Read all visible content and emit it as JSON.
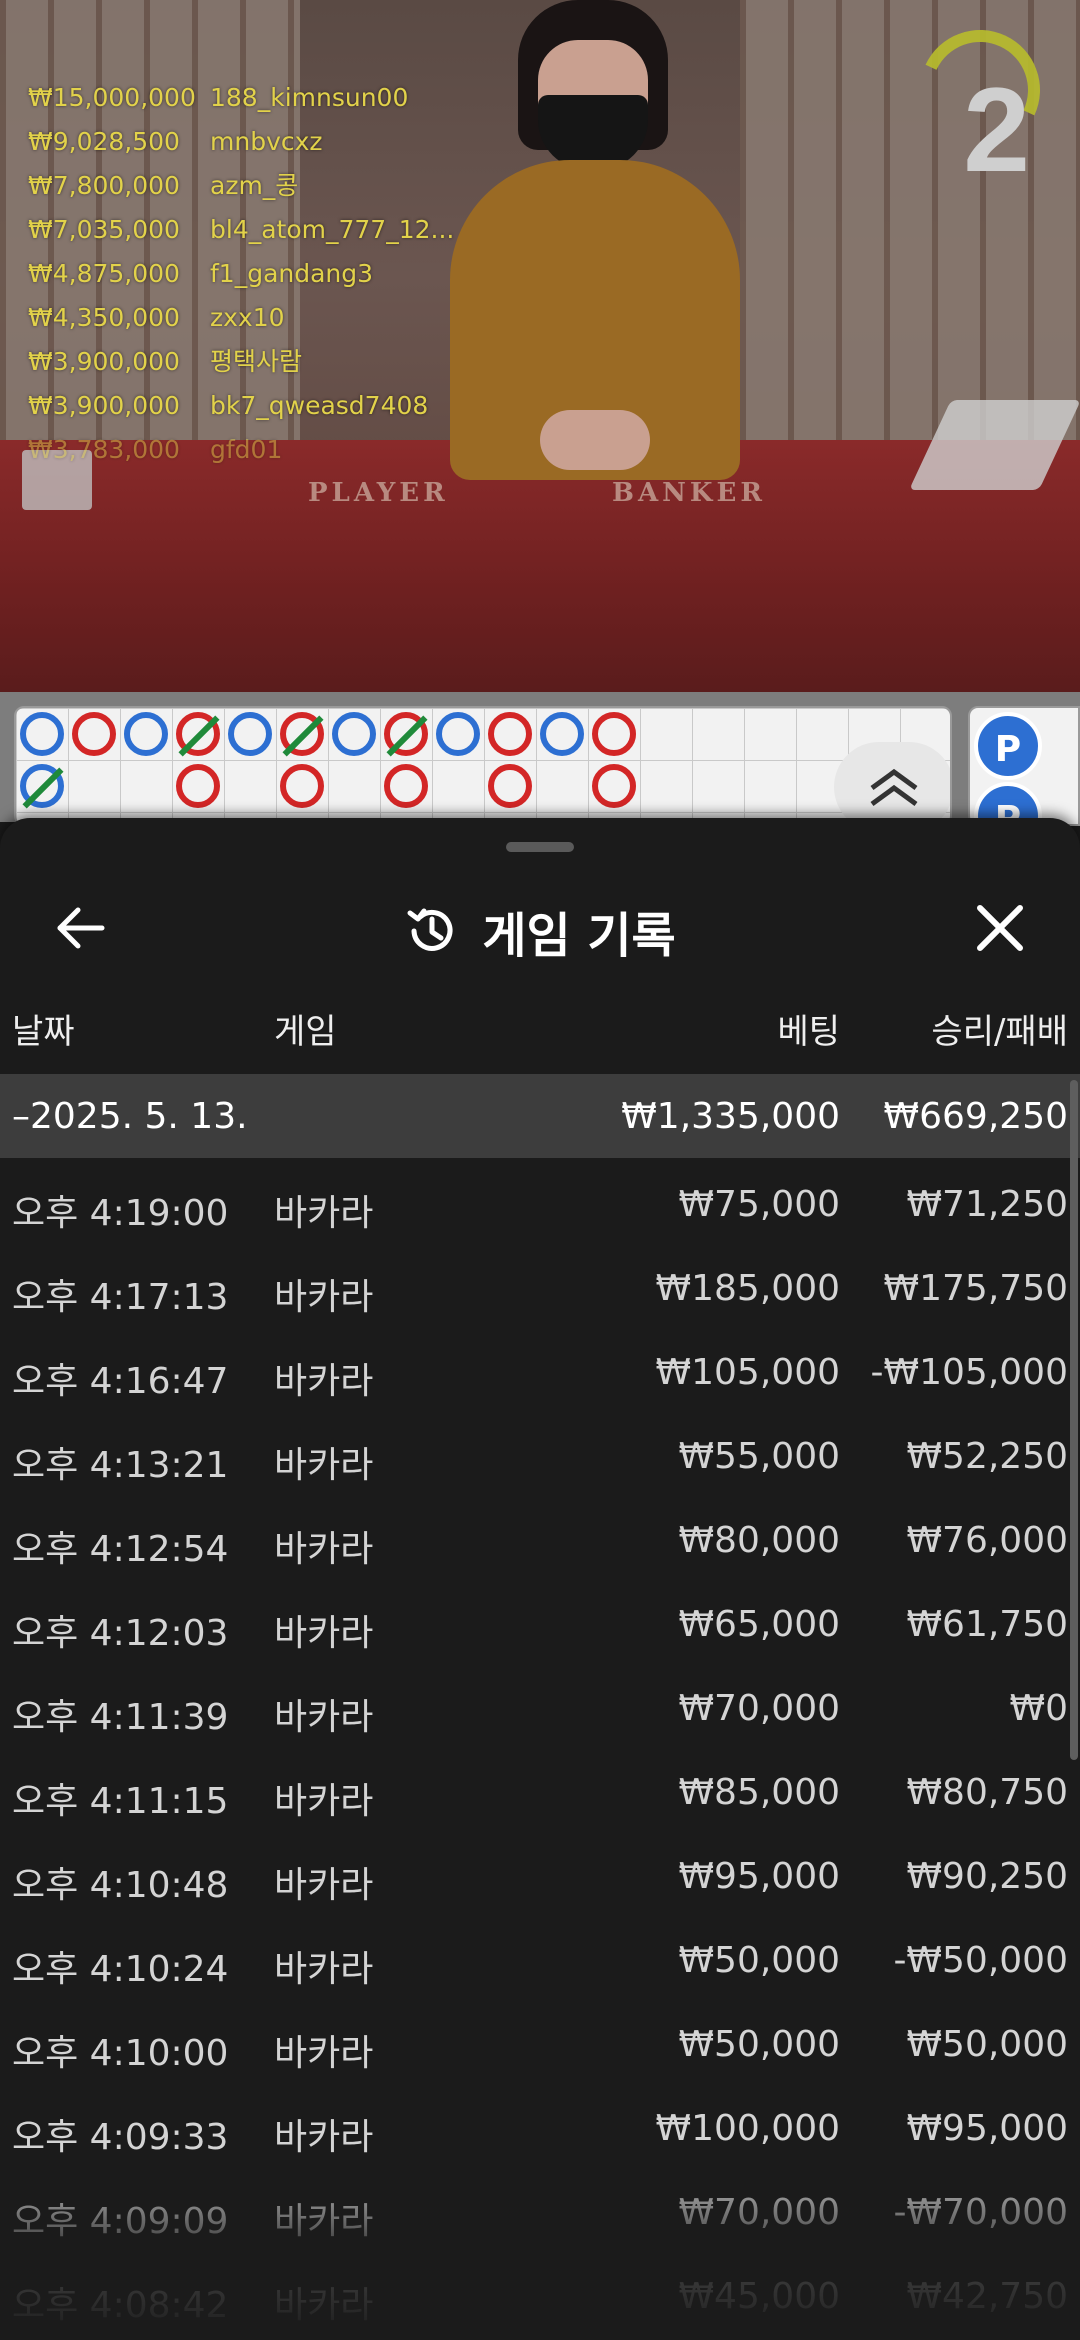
{
  "top_wins": [
    {
      "amount": "₩15,000,000",
      "user": "188_kimnsun00"
    },
    {
      "amount": "₩9,028,500",
      "user": "mnbvcxz"
    },
    {
      "amount": "₩7,800,000",
      "user": "azm_콩"
    },
    {
      "amount": "₩7,035,000",
      "user": "bl4_atom_777_12..."
    },
    {
      "amount": "₩4,875,000",
      "user": "f1_gandang3"
    },
    {
      "amount": "₩4,350,000",
      "user": "zxx10"
    },
    {
      "amount": "₩3,900,000",
      "user": "평택사람"
    },
    {
      "amount": "₩3,900,000",
      "user": "bk7_qweasd7408"
    },
    {
      "amount": "₩3,783,000",
      "user": "gfd01"
    }
  ],
  "timer": {
    "countdown": "2"
  },
  "table": {
    "player_label": "PLAYER",
    "banker_label": "BANKER"
  },
  "side_road": {
    "badge": "P"
  },
  "sheet": {
    "title": "게임 기록",
    "columns": {
      "date": "날짜",
      "game": "게임",
      "bet": "베팅",
      "win_loss": "승리/패배"
    },
    "summary": {
      "date": "–2025. 5. 13.",
      "bet": "₩1,335,000",
      "win_loss": "₩669,250"
    },
    "rows": [
      {
        "time": "오후 4:19:00",
        "game": "바카라",
        "bet": "₩75,000",
        "win_loss": "₩71,250"
      },
      {
        "time": "오후 4:17:13",
        "game": "바카라",
        "bet": "₩185,000",
        "win_loss": "₩175,750"
      },
      {
        "time": "오후 4:16:47",
        "game": "바카라",
        "bet": "₩105,000",
        "win_loss": "-₩105,000"
      },
      {
        "time": "오후 4:13:21",
        "game": "바카라",
        "bet": "₩55,000",
        "win_loss": "₩52,250"
      },
      {
        "time": "오후 4:12:54",
        "game": "바카라",
        "bet": "₩80,000",
        "win_loss": "₩76,000"
      },
      {
        "time": "오후 4:12:03",
        "game": "바카라",
        "bet": "₩65,000",
        "win_loss": "₩61,750"
      },
      {
        "time": "오후 4:11:39",
        "game": "바카라",
        "bet": "₩70,000",
        "win_loss": "₩0"
      },
      {
        "time": "오후 4:11:15",
        "game": "바카라",
        "bet": "₩85,000",
        "win_loss": "₩80,750"
      },
      {
        "time": "오후 4:10:48",
        "game": "바카라",
        "bet": "₩95,000",
        "win_loss": "₩90,250"
      },
      {
        "time": "오후 4:10:24",
        "game": "바카라",
        "bet": "₩50,000",
        "win_loss": "-₩50,000"
      },
      {
        "time": "오후 4:10:00",
        "game": "바카라",
        "bet": "₩50,000",
        "win_loss": "₩50,000"
      },
      {
        "time": "오후 4:09:33",
        "game": "바카라",
        "bet": "₩100,000",
        "win_loss": "₩95,000"
      },
      {
        "time": "오후 4:09:09",
        "game": "바카라",
        "bet": "₩70,000",
        "win_loss": "-₩70,000"
      },
      {
        "time": "오후 4:08:42",
        "game": "바카라",
        "bet": "₩45,000",
        "win_loss": "₩42,750"
      }
    ]
  },
  "icons": {
    "back": "arrow-left-icon",
    "history": "history-icon",
    "close": "close-icon",
    "expand": "chevron-double-up-icon"
  },
  "colors": {
    "banker_red": "#d32626",
    "player_blue": "#2d6fd2",
    "tie_green": "#1f8a3a",
    "win_text": "#e2d24a"
  }
}
